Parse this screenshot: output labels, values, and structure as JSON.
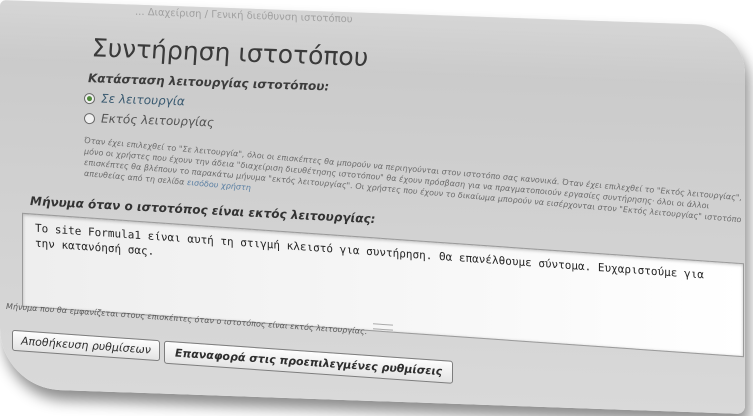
{
  "breadcrumb": "... Διαχείριση / Γενική διεύθυνση ιστοτόπου",
  "page_title": "Συντήρηση ιστοτόπου",
  "site_status": {
    "label": "Κατάσταση λειτουργίας ιστοτόπου:",
    "options": [
      {
        "label": "Σε λειτουργία",
        "checked": true
      },
      {
        "label": "Εκτός λειτουργίας",
        "checked": false
      }
    ]
  },
  "description": {
    "text": "Όταν έχει επιλεχθεί το \"Σε λειτουργία\", όλοι οι επισκέπτες θα μπορούν να περιηγούνται στον ιστοτόπο σας κανονικά. Όταν έχει επιλεχθεί το \"Εκτός λειτουργίας\", μόνο οι χρήστες που έχουν την άδεια \"διαχείριση διευθέτησης ιστοτόπου\" θα έχουν πρόσβαση για να πραγματοποιούν εργασίες συντήρησης· όλοι οι άλλοι επισκέπτες θα βλέπουν το παρακάτω μήνυμα \"εκτός λειτουργίας\". Οι χρήστες που έχουν το δικαίωμα μπορούν να εισέρχονται στον \"Εκτός λειτουργίας\" ιστοτόπο απευθείας από τη σελίδα",
    "link": "εισόδου χρήστη"
  },
  "offline_message": {
    "label": "Μήνυμα όταν ο ιστοτόπος είναι εκτός λειτουργίας:",
    "value": "Το site Formula1 είναι αυτή τη στιγμή κλειστό για συντήρηση. Θα επανέλθουμε σύντομα. Ευχαριστούμε για την κατανόησή σας.",
    "help": "Μήνυμα που θα εμφανίζεται στους επισκέπτες όταν ο ιστοτόπος είναι εκτός λειτουργίας."
  },
  "buttons": {
    "save": "Αποθήκευση ρυθμίσεων",
    "reset": "Επαναφορά στις προεπιλεγμένες ρυθμίσεις"
  },
  "colors": {
    "panel": "#cfcfcf",
    "accent_link": "#5a7fa3",
    "radio_checked": "#4f8a3a"
  }
}
